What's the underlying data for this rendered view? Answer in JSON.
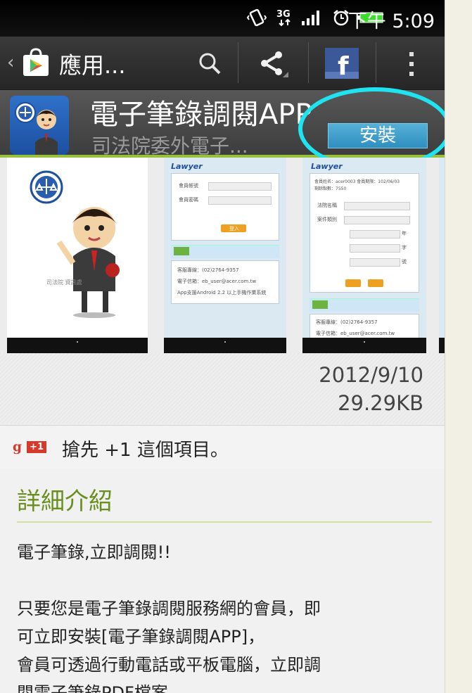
{
  "status_bar": {
    "time": "下午 5:09"
  },
  "action_bar": {
    "title": "應用..."
  },
  "app": {
    "title": "電子筆錄調閱APP",
    "developer": "司法院委外電子...",
    "install_label": "安裝"
  },
  "screenshots": {
    "shot1_caption": "司法院 資訊處",
    "shot2": {
      "logo": "Lawyer",
      "field1_label": "會員帳號",
      "field2_label": "會員密碼",
      "login_label": "登入",
      "info_line1": "客服專線：(02)2764-9357",
      "info_line2": "電子信箱：eb_user@acer.com.tw",
      "info_line3": "App支援Android 2.2 以上手機作業系統"
    },
    "shot3": {
      "logo": "Lawyer",
      "line1": "會員姓名：acer0003  會員期限：102/06/03",
      "line2": "剩餘點數：7550",
      "label_court": "法院名稱",
      "label_case": "案件類別",
      "label_year": "年",
      "label_word": "字",
      "label_no": "號",
      "info_line1": "客服專線：(02)2764-9357",
      "info_line2": "電子信箱：eb_user@acer.com.tw"
    }
  },
  "meta": {
    "date": "2012/9/10",
    "size": "29.29KB"
  },
  "plus_one": {
    "badge": "+1",
    "label": "搶先 +1 這個項目。"
  },
  "details": {
    "title": "詳細介紹",
    "line1": "電子筆錄,立即調閱!!",
    "line2": "只要您是電子筆錄調閱服務網的會員，即",
    "line3": "可立即安裝[電子筆錄調閱APP]，",
    "line4": "會員可透過行動電話或平板電腦，立即調",
    "line5": "閱電子筆錄PDF檔案。"
  },
  "colors": {
    "accent_green": "#98c03b",
    "install_blue": "#2f8fc0",
    "highlight_cyan": "#1fe4f0",
    "details_title": "#6a8f1f"
  },
  "icons": [
    "vibrate-icon",
    "3g-icon",
    "signal-icon",
    "alarm-icon",
    "battery-icon",
    "play-store-icon",
    "search-icon",
    "share-icon",
    "facebook-icon",
    "overflow-menu-icon",
    "gplus-icon"
  ]
}
